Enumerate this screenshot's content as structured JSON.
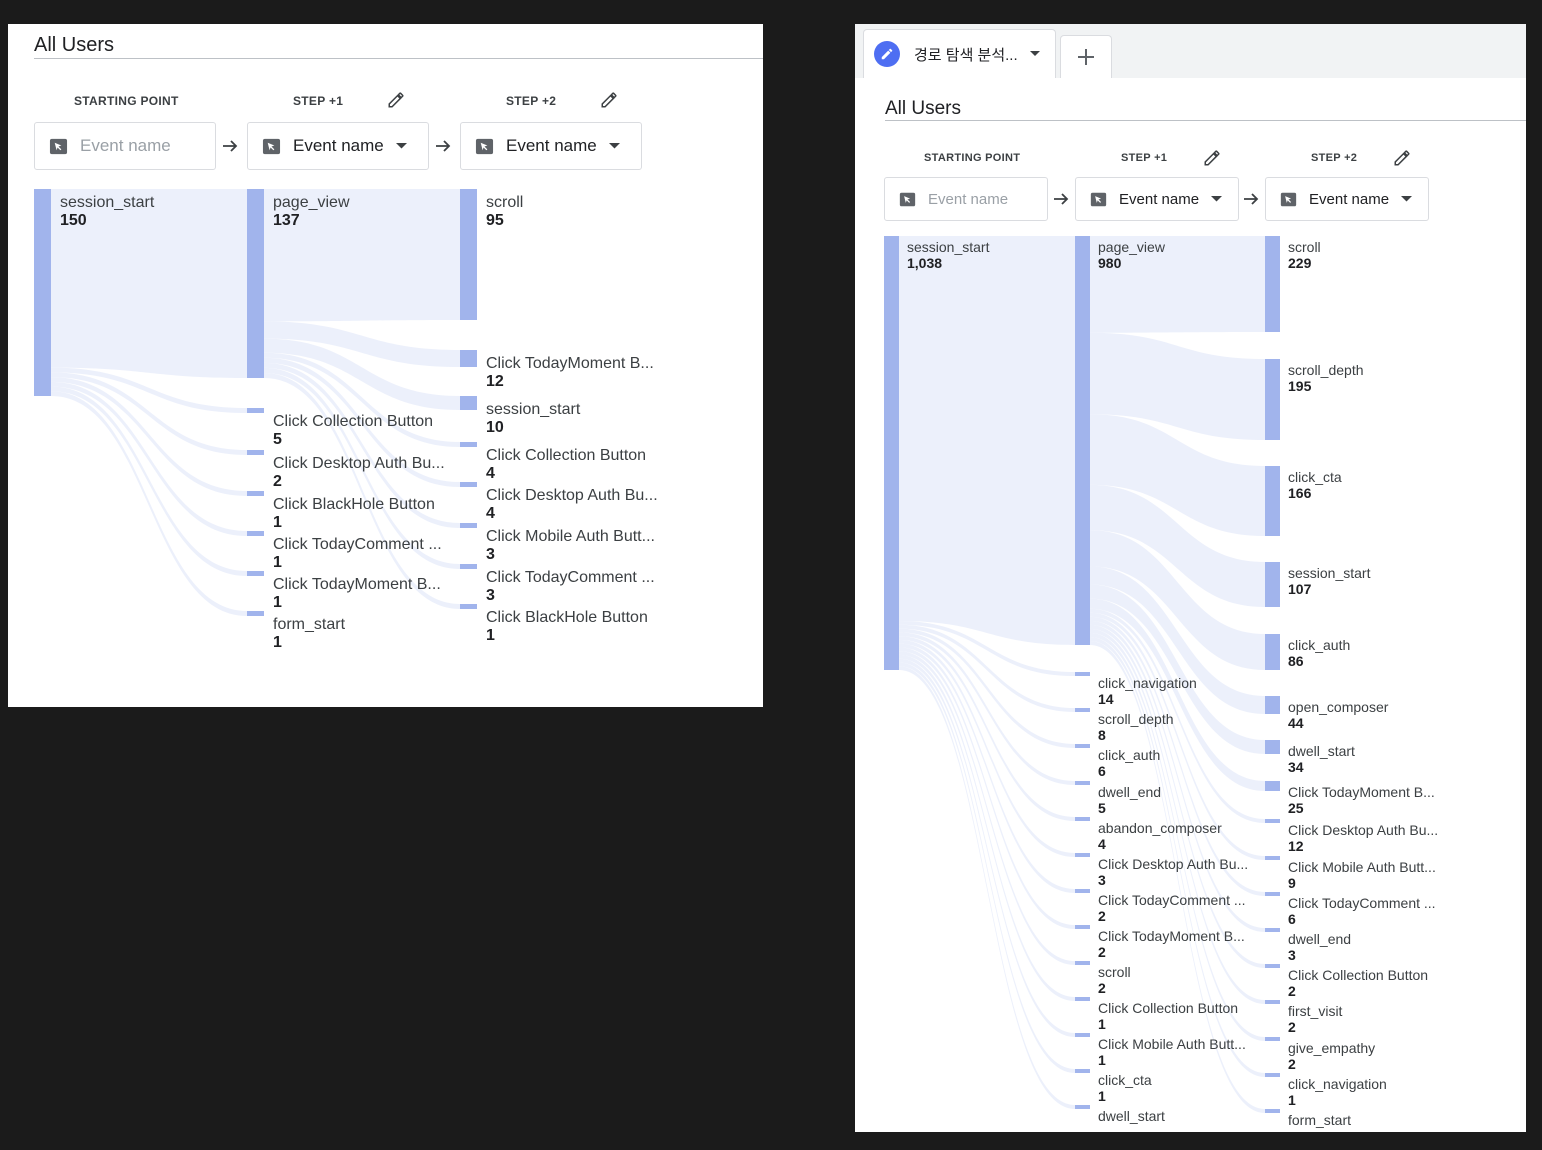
{
  "colors": {
    "bar": "#a1b4ec",
    "flow": "#e9edfa",
    "accent": "#4e6ef2"
  },
  "left": {
    "title": "All Users",
    "steps": [
      {
        "header": "STARTING POINT",
        "placeholder": "Event name",
        "value": "",
        "editable": false
      },
      {
        "header": "STEP +1",
        "placeholder": "",
        "value": "Event name",
        "editable": true
      },
      {
        "header": "STEP +2",
        "placeholder": "",
        "value": "Event name",
        "editable": true
      }
    ],
    "columns": [
      [
        {
          "name": "session_start",
          "count": "150"
        }
      ],
      [
        {
          "name": "page_view",
          "count": "137"
        },
        {
          "name": "Click Collection Button",
          "count": "5"
        },
        {
          "name": "Click Desktop Auth Bu...",
          "count": "2"
        },
        {
          "name": "Click BlackHole Button",
          "count": "1"
        },
        {
          "name": "Click TodayComment ...",
          "count": "1"
        },
        {
          "name": "Click TodayMoment B...",
          "count": "1"
        },
        {
          "name": "form_start",
          "count": "1"
        }
      ],
      [
        {
          "name": "scroll",
          "count": "95"
        },
        {
          "name": "Click TodayMoment B...",
          "count": "12"
        },
        {
          "name": "session_start",
          "count": "10"
        },
        {
          "name": "Click Collection Button",
          "count": "4"
        },
        {
          "name": "Click Desktop Auth Bu...",
          "count": "4"
        },
        {
          "name": "Click Mobile Auth Butt...",
          "count": "3"
        },
        {
          "name": "Click TodayComment ...",
          "count": "3"
        },
        {
          "name": "Click BlackHole Button",
          "count": "1"
        }
      ]
    ]
  },
  "right": {
    "tab_label": "경로 탐색 분석...",
    "add_tab_icon": "plus-icon",
    "title": "All Users",
    "steps": [
      {
        "header": "STARTING POINT",
        "placeholder": "Event name",
        "value": "",
        "editable": false
      },
      {
        "header": "STEP +1",
        "placeholder": "",
        "value": "Event name",
        "editable": true
      },
      {
        "header": "STEP +2",
        "placeholder": "",
        "value": "Event name",
        "editable": true
      }
    ],
    "columns": [
      [
        {
          "name": "session_start",
          "count": "1,038"
        }
      ],
      [
        {
          "name": "page_view",
          "count": "980"
        },
        {
          "name": "click_navigation",
          "count": "14"
        },
        {
          "name": "scroll_depth",
          "count": "8"
        },
        {
          "name": "click_auth",
          "count": "6"
        },
        {
          "name": "dwell_end",
          "count": "5"
        },
        {
          "name": "abandon_composer",
          "count": "4"
        },
        {
          "name": "Click Desktop Auth Bu...",
          "count": "3"
        },
        {
          "name": "Click TodayComment ...",
          "count": "2"
        },
        {
          "name": "Click TodayMoment B...",
          "count": "2"
        },
        {
          "name": "scroll",
          "count": "2"
        },
        {
          "name": "Click Collection Button",
          "count": "1"
        },
        {
          "name": "Click Mobile Auth Butt...",
          "count": "1"
        },
        {
          "name": "click_cta",
          "count": "1"
        },
        {
          "name": "dwell_start",
          "count": ""
        }
      ],
      [
        {
          "name": "scroll",
          "count": "229"
        },
        {
          "name": "scroll_depth",
          "count": "195"
        },
        {
          "name": "click_cta",
          "count": "166"
        },
        {
          "name": "session_start",
          "count": "107"
        },
        {
          "name": "click_auth",
          "count": "86"
        },
        {
          "name": "open_composer",
          "count": "44"
        },
        {
          "name": "dwell_start",
          "count": "34"
        },
        {
          "name": "Click TodayMoment B...",
          "count": "25"
        },
        {
          "name": "Click Desktop Auth Bu...",
          "count": "12"
        },
        {
          "name": "Click Mobile Auth Butt...",
          "count": "9"
        },
        {
          "name": "Click TodayComment ...",
          "count": "6"
        },
        {
          "name": "dwell_end",
          "count": "3"
        },
        {
          "name": "Click Collection Button",
          "count": "2"
        },
        {
          "name": "first_visit",
          "count": "2"
        },
        {
          "name": "give_empathy",
          "count": "2"
        },
        {
          "name": "click_navigation",
          "count": "1"
        },
        {
          "name": "form_start",
          "count": ""
        }
      ]
    ]
  }
}
